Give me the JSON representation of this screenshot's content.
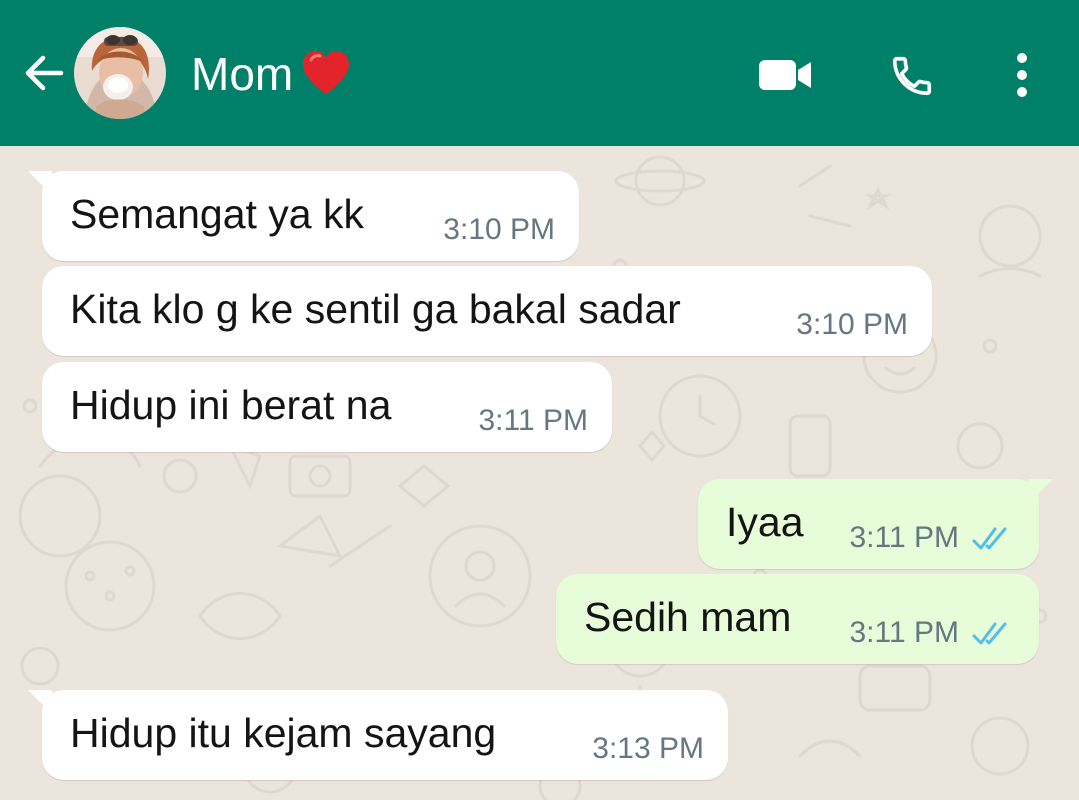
{
  "header": {
    "contact_name": "Mom",
    "name_emoji": "red-heart",
    "back_icon": "arrow-left-icon",
    "video_icon": "video-call-icon",
    "call_icon": "phone-icon",
    "menu_icon": "more-vertical-icon",
    "background_color": "#008069"
  },
  "chat": {
    "wallpaper_color": "#ece5dd",
    "incoming_bubble_color": "#ffffff",
    "outgoing_bubble_color": "#e7fcd8",
    "read_ticks_color": "#53bdeb",
    "messages": [
      {
        "direction": "incoming",
        "text": "Semangat ya kk",
        "time": "3:10 PM"
      },
      {
        "direction": "incoming",
        "text": "Kita klo g ke sentil ga bakal sadar",
        "time": "3:10 PM"
      },
      {
        "direction": "incoming",
        "text": "Hidup ini berat na",
        "time": "3:11 PM"
      },
      {
        "direction": "outgoing",
        "text": "Iyaa",
        "time": "3:11 PM",
        "status": "read"
      },
      {
        "direction": "outgoing",
        "text": "Sedih mam",
        "time": "3:11 PM",
        "status": "read"
      },
      {
        "direction": "incoming",
        "text": "Hidup itu kejam sayang",
        "time": "3:13 PM"
      }
    ]
  }
}
